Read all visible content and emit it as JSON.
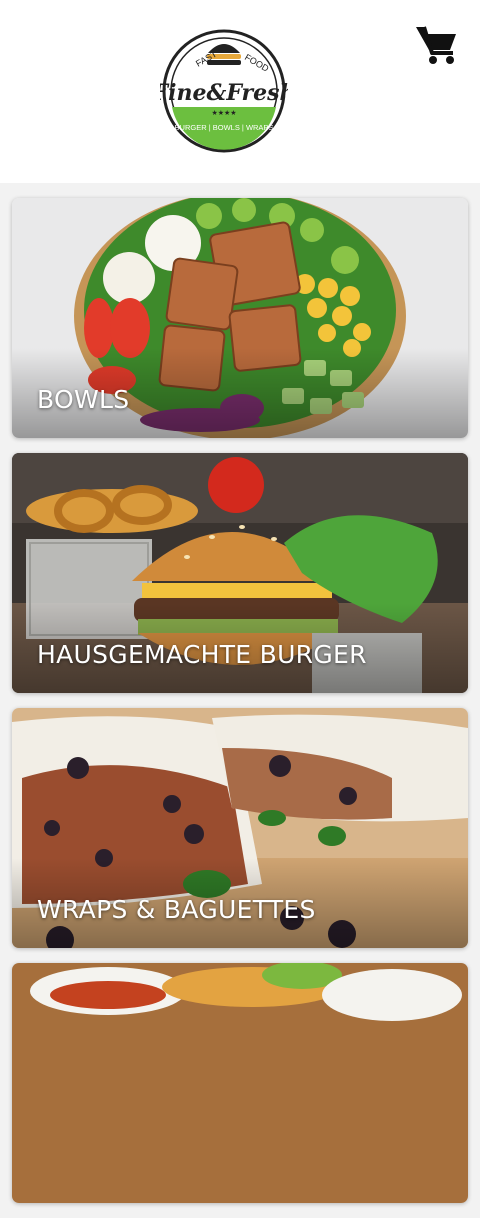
{
  "header": {
    "logo": {
      "top_left": "FAST",
      "top_right": "FOOD",
      "brand": "Fine&Fresh",
      "tagline": "BURGER | BOWLS | WRAPS",
      "stars": "★★★★",
      "colors": {
        "green": "#6cbf3f",
        "dark": "#222222",
        "bun": "#e7a83a"
      }
    },
    "cart_icon": "shopping-cart-icon"
  },
  "categories": [
    {
      "label": "BOWLS"
    },
    {
      "label": "HAUSGEMACHTE BURGER"
    },
    {
      "label": "WRAPS & BAGUETTES"
    },
    {
      "label": ""
    }
  ]
}
